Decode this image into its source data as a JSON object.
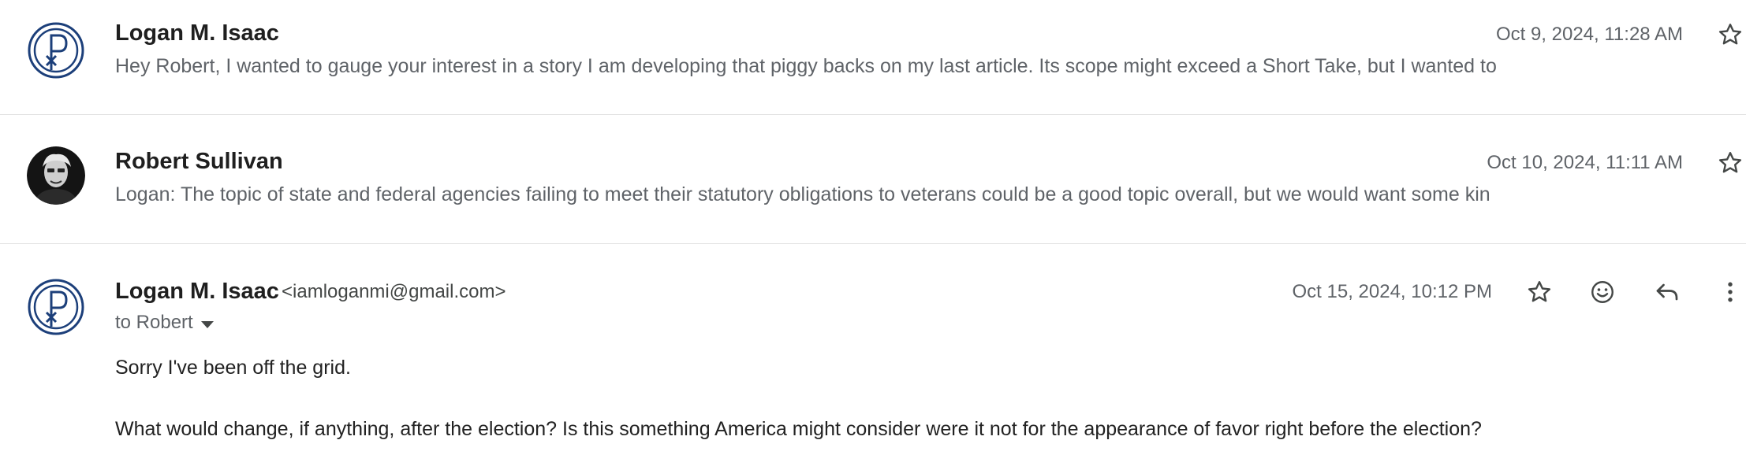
{
  "messages": [
    {
      "sender": "Logan M. Isaac",
      "date": "Oct 9, 2024, 11:28 AM",
      "snippet": "Hey Robert, I wanted to gauge your interest in a story I am developing that piggy backs on my last article. Its scope might exceed a Short Take, but I wanted to",
      "avatar_icon": "chi-rho-logo-icon"
    },
    {
      "sender": "Robert Sullivan",
      "date": "Oct 10, 2024, 11:11 AM",
      "snippet": "Logan: The topic of state and federal agencies failing to meet their statutory obligations to veterans could be a good topic overall, but we would want some kin",
      "avatar_icon": "profile-photo"
    },
    {
      "sender": "Logan M. Isaac",
      "email": "<iamloganmi@gmail.com>",
      "date": "Oct 15, 2024, 10:12 PM",
      "to": "to Robert",
      "body": [
        "Sorry I've been off the grid.",
        "What would change, if anything, after the election? Is this something America might consider were it not for the appearance of favor right before the election?"
      ],
      "avatar_icon": "chi-rho-logo-icon"
    }
  ],
  "icons": {
    "star": "star-outline-icon",
    "emoji": "add-reaction-icon",
    "reply": "reply-icon",
    "more": "more-vert-icon"
  },
  "colors": {
    "logo_blue": "#1c3f7a",
    "text_primary": "#1f1f1f",
    "text_secondary": "#5f6368",
    "divider": "#e3e3e3"
  }
}
